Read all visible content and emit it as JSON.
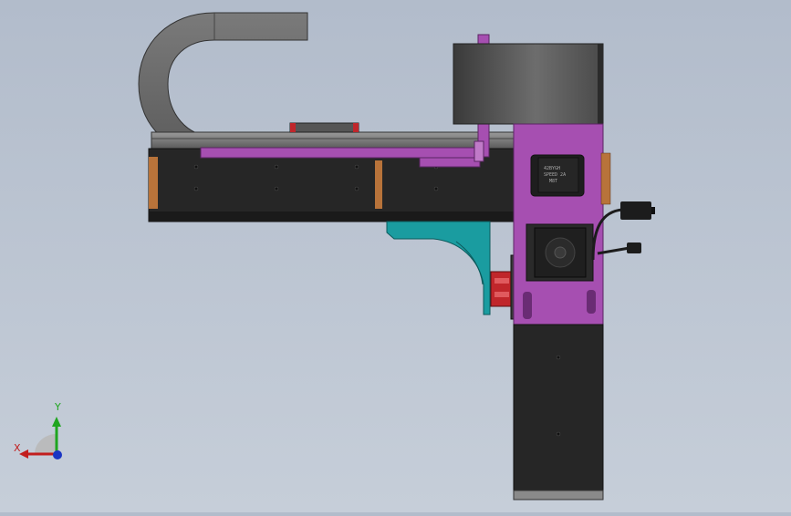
{
  "viewport": {
    "background_top": "#b2bccb",
    "background_bottom": "#c6ced9"
  },
  "model": {
    "colors": {
      "body_dark": "#2b2b2b",
      "body_black": "#1e1e1e",
      "accent_purple": "#a64fb1",
      "accent_purple_light": "#c07ac8",
      "cable_chain": "#6b6b6b",
      "teal_bracket": "#1a9ca0",
      "red_block": "#c0262b",
      "copper_strip": "#b8733a",
      "gray_rail": "#8a8a8a"
    },
    "motor_label_lines": [
      "42BYGH",
      "SPEED 2A",
      "M8T"
    ]
  },
  "triad": {
    "y_label": "Y",
    "x_label": "X",
    "y_color": "#1fa51f",
    "x_color": "#c21e1e",
    "z_color": "#1a35c4"
  }
}
